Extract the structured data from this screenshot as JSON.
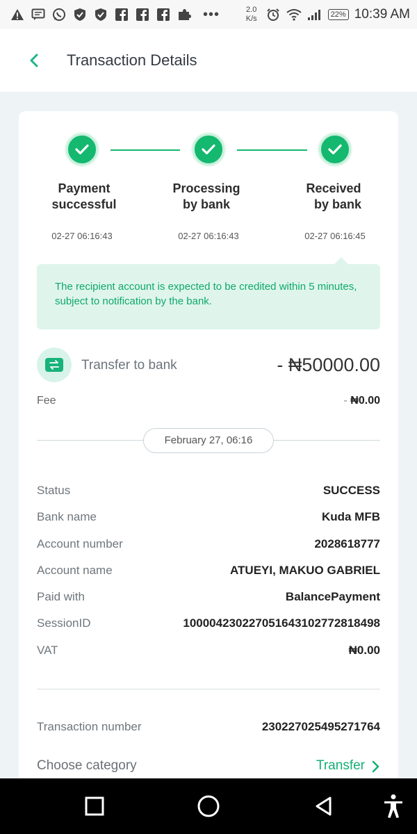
{
  "status_bar": {
    "net_speed_value": "2.0",
    "net_speed_unit": "K/s",
    "battery": "22%",
    "time": "10:39 AM",
    "icons": [
      "warning-icon",
      "message-icon",
      "whatsapp-icon",
      "shield-icon",
      "shield-icon",
      "facebook-icon",
      "facebook-icon",
      "facebook-icon",
      "puzzle-icon",
      "alarm-icon",
      "wifi-icon",
      "signal-icon",
      "battery-icon"
    ]
  },
  "header": {
    "title": "Transaction Details"
  },
  "steps": [
    {
      "label_line1": "Payment",
      "label_line2": "successful",
      "time": "02-27 06:16:43"
    },
    {
      "label_line1": "Processing",
      "label_line2": "by bank",
      "time": "02-27 06:16:43"
    },
    {
      "label_line1": "Received",
      "label_line2": "by bank",
      "time": "02-27 06:16:45"
    }
  ],
  "notice": "The recipient account is expected to be credited within 5 minutes, subject to notification by the bank.",
  "transaction": {
    "label": "Transfer to bank",
    "amount_prefix": "- ",
    "amount": "₦50000.00",
    "fee_label": "Fee",
    "fee_prefix": "- ",
    "fee_value": "₦0.00"
  },
  "date": "February 27, 06:16",
  "details": [
    {
      "label": "Status",
      "value": "SUCCESS"
    },
    {
      "label": "Bank name",
      "value": "Kuda MFB"
    },
    {
      "label": "Account number",
      "value": "2028618777"
    },
    {
      "label": "Account name",
      "value": "ATUEYI, MAKUO GABRIEL"
    },
    {
      "label": "Paid with",
      "value": "BalancePayment"
    },
    {
      "label": "SessionID",
      "value": "100004230227051643102772818498"
    },
    {
      "label": "VAT",
      "value": "₦0.00"
    }
  ],
  "transaction_number": {
    "label": "Transaction number",
    "value": "230227025495271764"
  },
  "category": {
    "label": "Choose category",
    "value": "Transfer"
  },
  "colors": {
    "accent": "#14b86f",
    "notice_bg": "#dff5ec",
    "page_bg": "#eef3f6"
  }
}
